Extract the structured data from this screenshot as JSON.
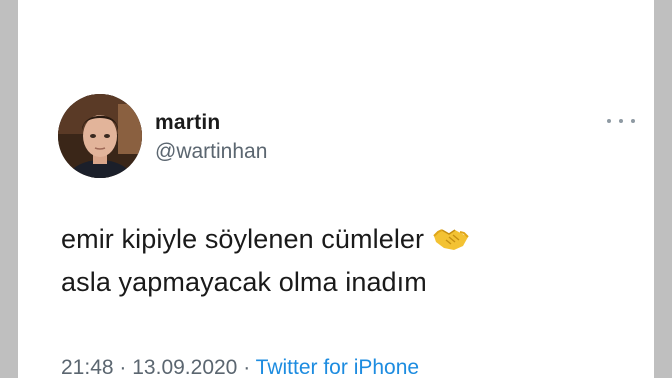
{
  "tweet": {
    "author": {
      "display_name": "martin",
      "handle": "@wartinhan"
    },
    "text_line_1": "emir kipiyle söylenen cümleler",
    "emoji": "handshake-emoji",
    "text_line_2": "asla yapmayacak olma inadım",
    "time": "21:48",
    "separator": "·",
    "date": "13.09.2020",
    "source": "Twitter for iPhone"
  },
  "colors": {
    "background": "#ffffff",
    "secondary_text": "#5b6670",
    "link": "#1d8ce0"
  }
}
